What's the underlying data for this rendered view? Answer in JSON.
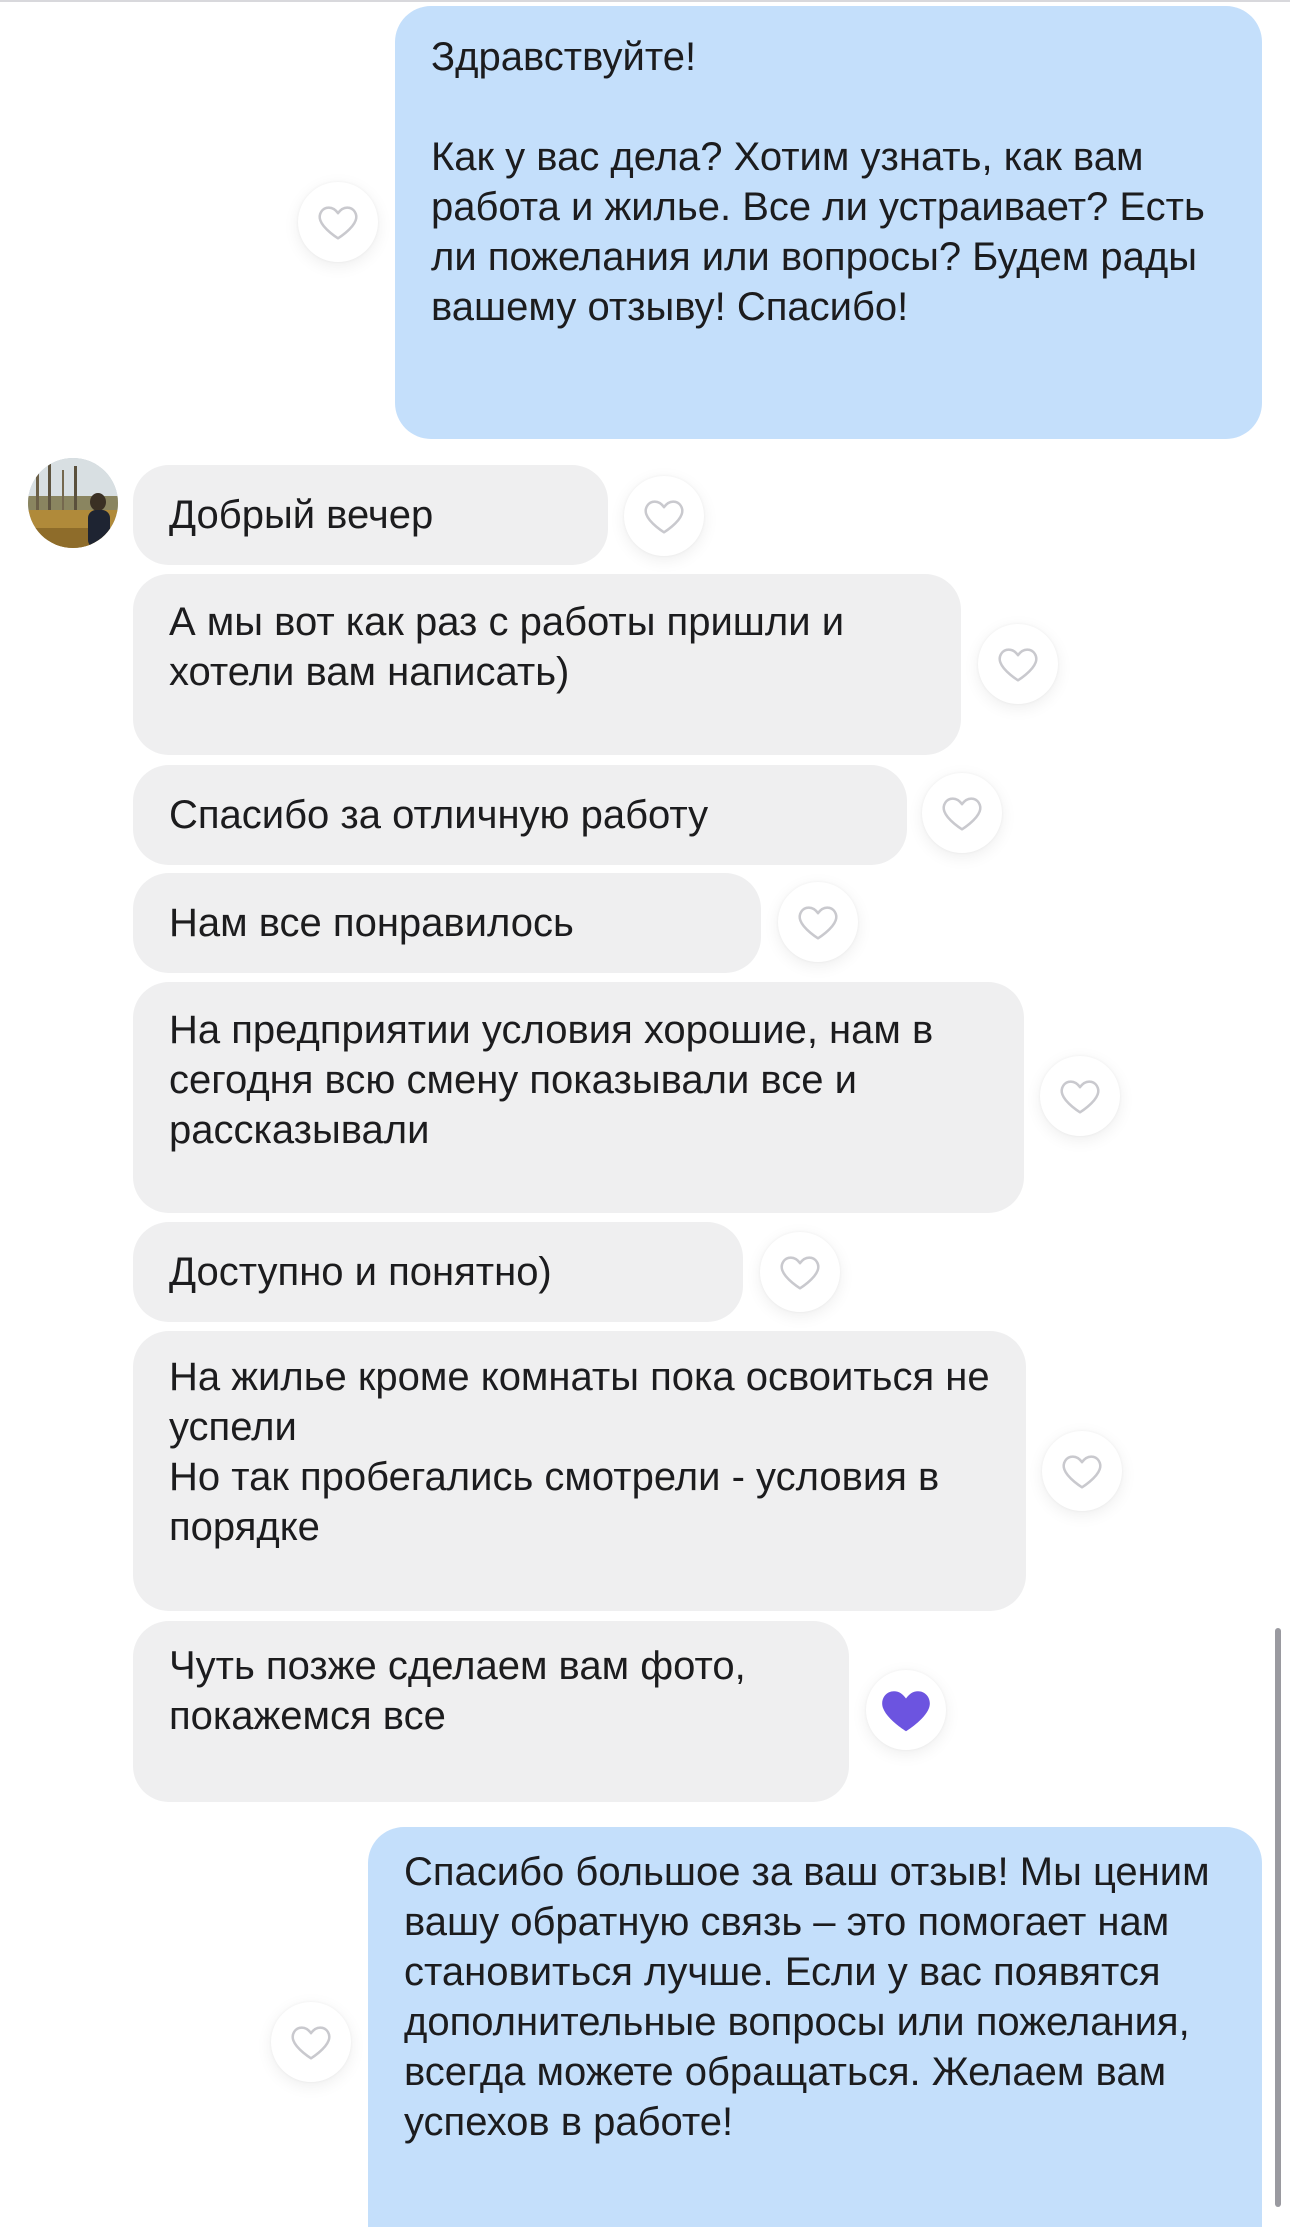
{
  "colors": {
    "outgoing_bubble": "#c4dffb",
    "incoming_bubble": "#efeff0",
    "heart_outline": "#c9c9ce",
    "heart_filled": "#6c54e0"
  },
  "messages": [
    {
      "direction": "outgoing",
      "text": "Здравствуйте!\n\nКак у вас дела? Хотим узнать, как вам работа и жилье. Все ли устраивает? Есть ли пожелания или вопросы? Будем рады вашему отзыву! Спасибо!",
      "liked": false
    },
    {
      "direction": "incoming",
      "text": "Добрый вечер",
      "liked": false
    },
    {
      "direction": "incoming",
      "text": "А мы вот как раз с работы пришли и хотели вам написать)",
      "liked": false
    },
    {
      "direction": "incoming",
      "text": "Спасибо за отличную работу",
      "liked": false
    },
    {
      "direction": "incoming",
      "text": "Нам все понравилось",
      "liked": false
    },
    {
      "direction": "incoming",
      "text": "На предприятии условия хорошие, нам в сегодня всю смену показывали все и рассказывали",
      "liked": false
    },
    {
      "direction": "incoming",
      "text": "Доступно и понятно)",
      "liked": false
    },
    {
      "direction": "incoming",
      "text": "На жилье кроме комнаты пока освоиться не успели\nНо так пробегались смотрели - условия в порядке",
      "liked": false
    },
    {
      "direction": "incoming",
      "text": "Чуть позже сделаем вам фото, покажемся все",
      "liked": true
    },
    {
      "direction": "outgoing",
      "text": "Спасибо большое за ваш отзыв! Мы ценим вашу обратную связь – это помогает нам становиться лучше. Если у вас появятся дополнительные вопросы или пожелания, всегда можете обращаться. Желаем вам успехов в работе!",
      "liked": false
    }
  ]
}
